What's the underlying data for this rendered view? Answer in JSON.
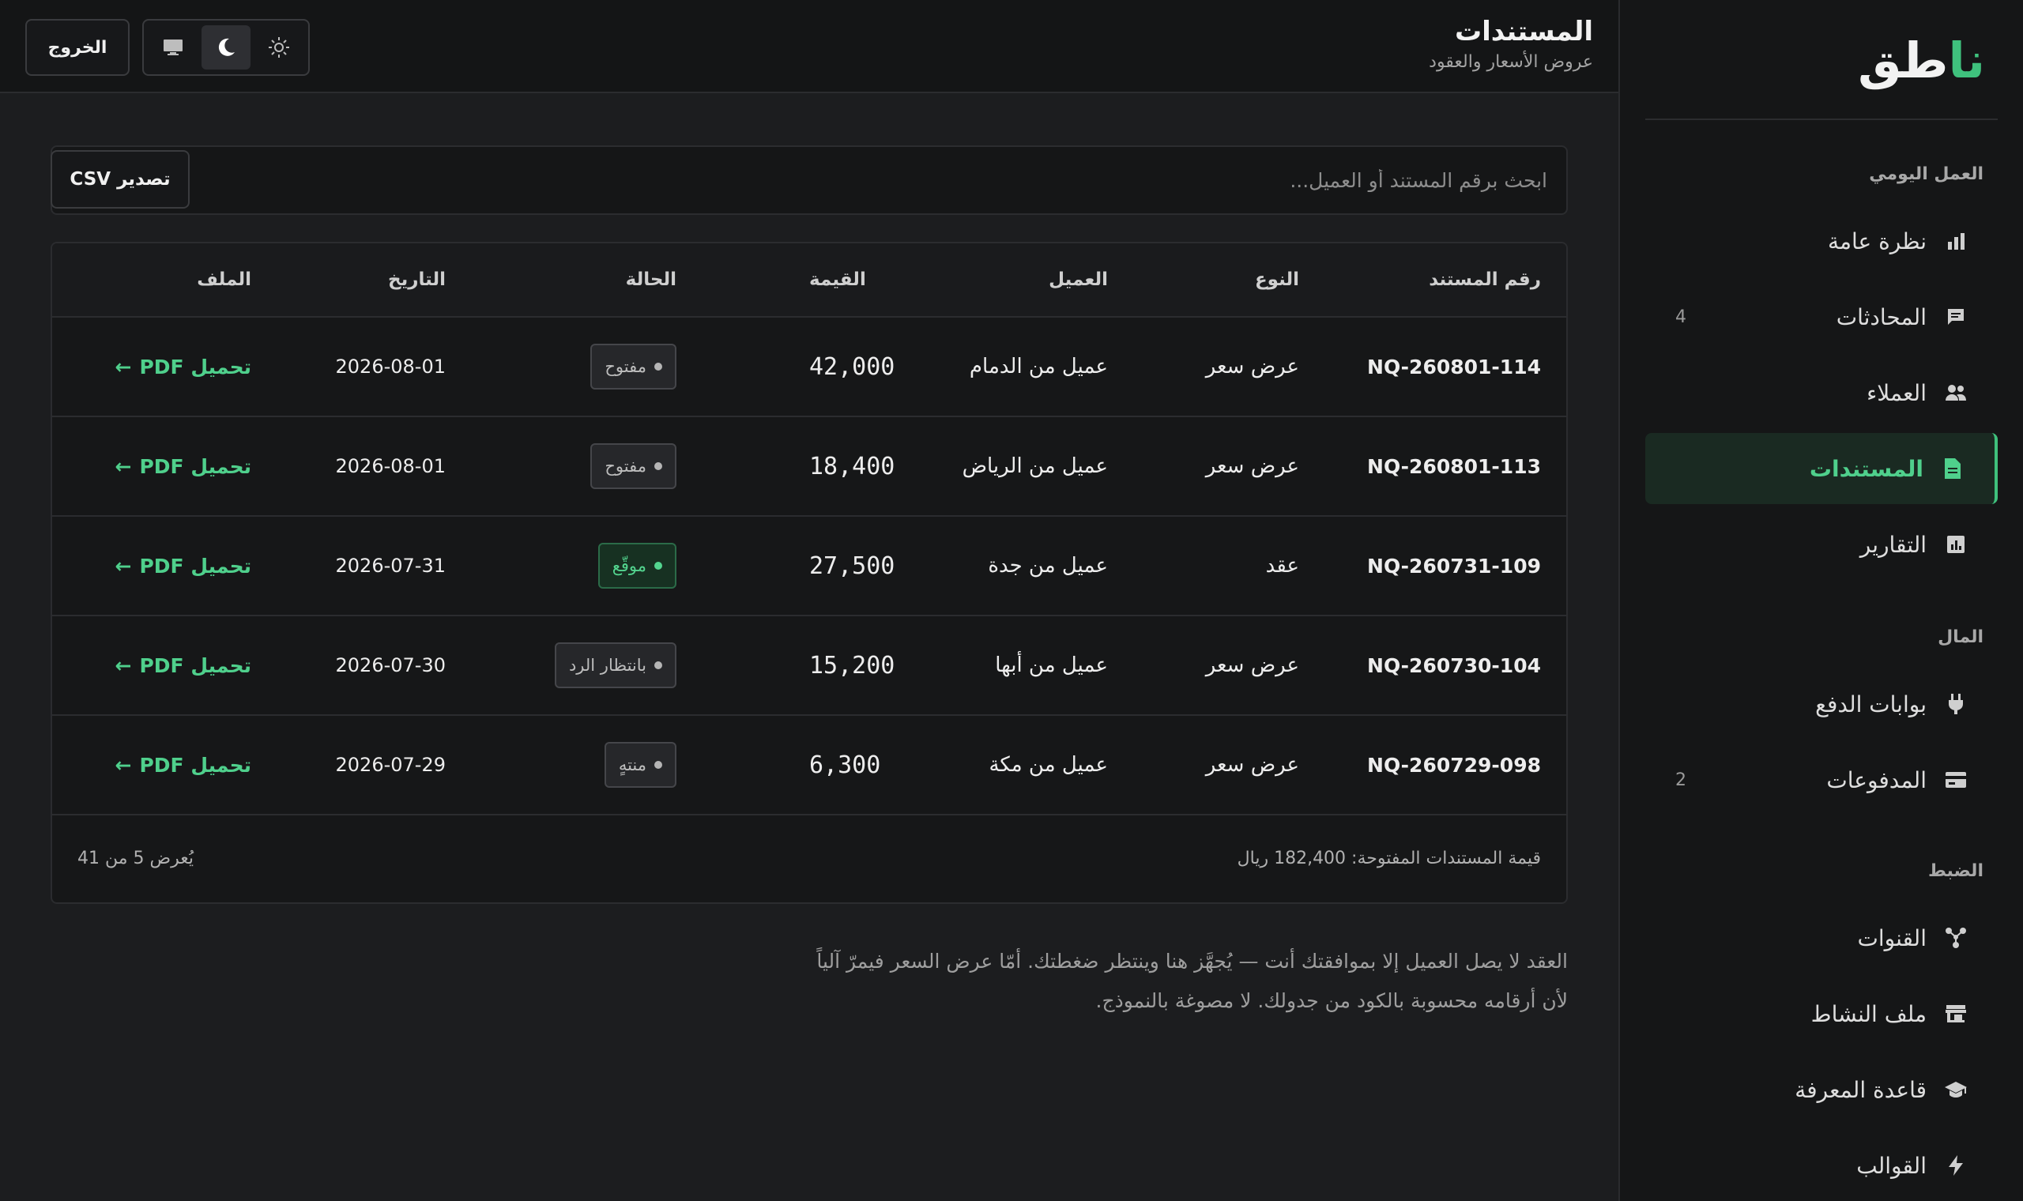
{
  "brand": {
    "logo_main": "طق",
    "logo_accent": "نا"
  },
  "header": {
    "title": "المستندات",
    "subtitle": "عروض الأسعار والعقود",
    "logout_label": "الخروج",
    "theme_options": [
      "light",
      "dark",
      "system"
    ],
    "theme_active": "dark"
  },
  "sidebar": {
    "sections": [
      {
        "label": "العمل اليومي"
      },
      {
        "label": "المال"
      },
      {
        "label": "الضبط"
      }
    ],
    "items": [
      {
        "label": "نظرة عامة",
        "icon": "bar-chart-icon",
        "count": ""
      },
      {
        "label": "المحادثات",
        "icon": "chat-icon",
        "count": "4"
      },
      {
        "label": "العملاء",
        "icon": "people-icon",
        "count": ""
      },
      {
        "label": "المستندات",
        "icon": "document-icon",
        "count": "",
        "active": true
      },
      {
        "label": "التقارير",
        "icon": "report-icon",
        "count": ""
      },
      {
        "label": "بوابات الدفع",
        "icon": "plug-icon",
        "count": ""
      },
      {
        "label": "المدفوعات",
        "icon": "card-icon",
        "count": "2"
      },
      {
        "label": "القنوات",
        "icon": "channels-icon",
        "count": ""
      },
      {
        "label": "ملف النشاط",
        "icon": "store-icon",
        "count": ""
      },
      {
        "label": "قاعدة المعرفة",
        "icon": "graduation-cap-icon",
        "count": ""
      },
      {
        "label": "القوالب",
        "icon": "lightning-icon",
        "count": ""
      }
    ]
  },
  "toolbar": {
    "search_placeholder": "ابحث برقم المستند أو العميل...",
    "search_value": "",
    "export_label": "تصدير CSV"
  },
  "table": {
    "columns": [
      "رقم المستند",
      "النوع",
      "العميل",
      "القيمة",
      "الحالة",
      "التاريخ",
      "الملف"
    ],
    "rows": [
      {
        "id": "NQ-260801-114",
        "type": "عرض سعر",
        "client": "عميل من الدمام",
        "value": "42,000",
        "status": "مفتوح",
        "status_color": "#b5b5b5",
        "date": "2026-08-01",
        "file": "تحميل PDF"
      },
      {
        "id": "NQ-260801-113",
        "type": "عرض سعر",
        "client": "عميل من الرياض",
        "value": "18,400",
        "status": "مفتوح",
        "status_color": "#b5b5b5",
        "date": "2026-08-01",
        "file": "تحميل PDF"
      },
      {
        "id": "NQ-260731-109",
        "type": "عقد",
        "client": "عميل من جدة",
        "value": "27,500",
        "status": "موقّع",
        "status_color": "#53d58f",
        "date": "2026-07-31",
        "file": "تحميل PDF"
      },
      {
        "id": "NQ-260730-104",
        "type": "عرض سعر",
        "client": "عميل من أبها",
        "value": "15,200",
        "status": "بانتظار الرد",
        "status_color": "#b5b5b5",
        "date": "2026-07-30",
        "file": "تحميل PDF"
      },
      {
        "id": "NQ-260729-098",
        "type": "عرض سعر",
        "client": "عميل من مكة",
        "value": "6,300",
        "status": "منتهٍ",
        "status_color": "#b5b5b5",
        "date": "2026-07-29",
        "file": "تحميل PDF"
      }
    ],
    "footer_sum": "قيمة المستندات المفتوحة: 182,400 ريال",
    "footer_count": "يُعرض 5 من 41"
  },
  "note": {
    "line1": "العقد لا يصل العميل إلا بموافقتك أنت — يُجهَّز هنا وينتظر ضغطتك. أمّا عرض السعر فيمرّ آلياً",
    "line2": "لأن أرقامه محسوبة بالكود من جدولك. لا مصوغة بالنموذج."
  },
  "colors": {
    "accent": "#3fc17d",
    "background": "#1c1d1f",
    "sidebar": "#151617"
  }
}
